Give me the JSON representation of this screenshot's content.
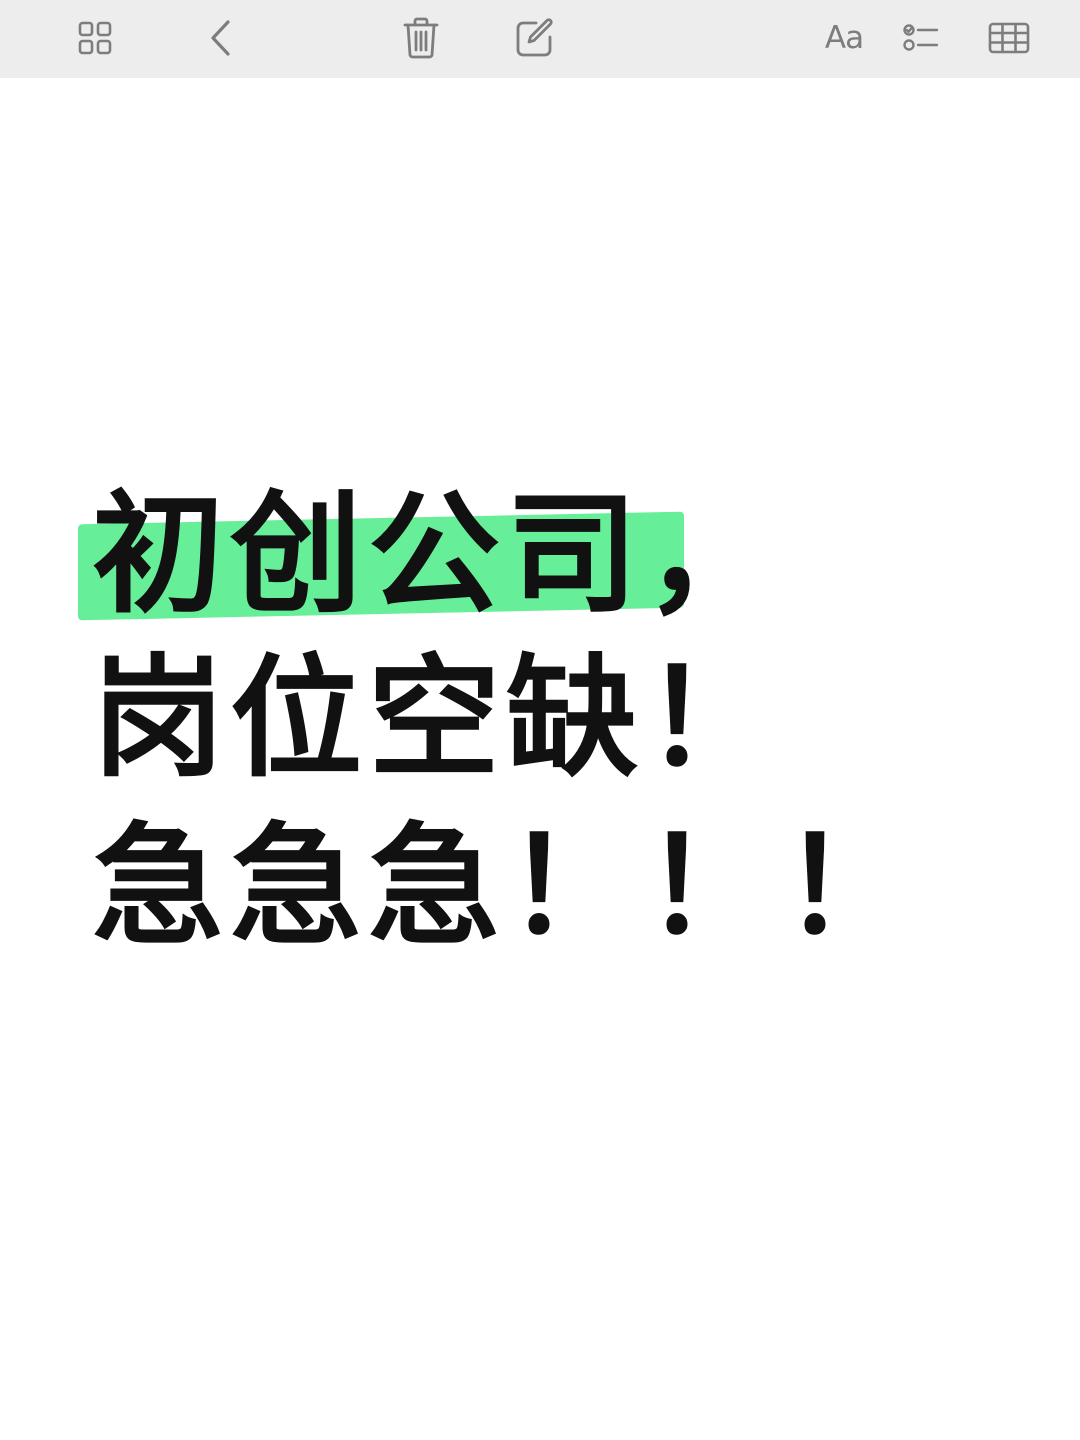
{
  "toolbar": {
    "icons": [
      "grid-icon",
      "chevron-left-icon",
      "trash-icon",
      "compose-icon",
      "text-format-icon",
      "checklist-icon",
      "table-icon"
    ],
    "format_label": "Aa",
    "icon_color": "#7d7d7d",
    "background": "#ededed"
  },
  "note": {
    "lines": [
      "初创公司，",
      "岗位空缺！",
      "急急急！！！"
    ],
    "highlight_color": "#67ee98",
    "text_color": "#111111"
  }
}
